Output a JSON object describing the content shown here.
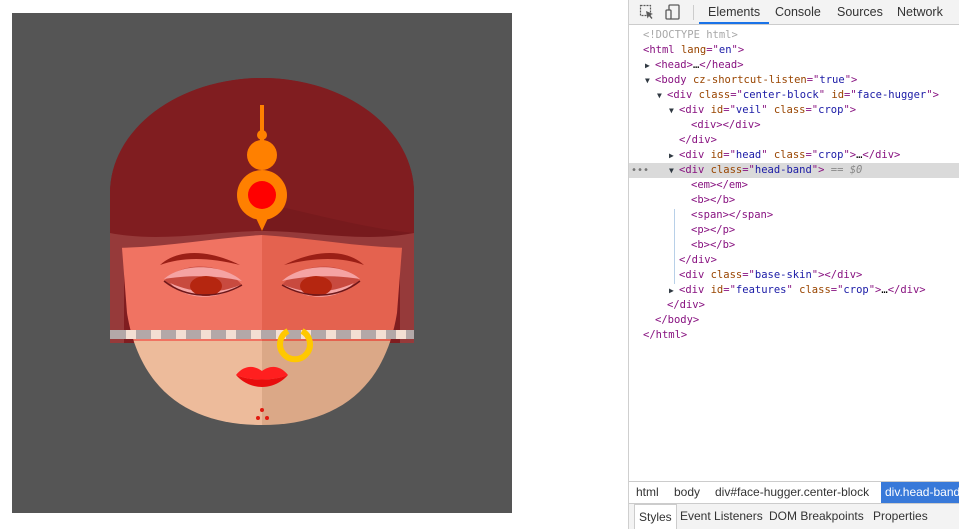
{
  "devtools": {
    "tabs": [
      {
        "label": "Elements",
        "active": true
      },
      {
        "label": "Console"
      },
      {
        "label": "Sources"
      },
      {
        "label": "Network"
      }
    ],
    "icons": [
      "select-element-icon",
      "device-toolbar-icon"
    ],
    "dom_lines": [
      {
        "tri": "",
        "parts": [
          [
            "doctype",
            "<!DOCTYPE html>"
          ]
        ]
      },
      {
        "tri": "",
        "parts": [
          [
            "tag",
            "<html "
          ],
          [
            "attr",
            "lang"
          ],
          [
            "tag",
            "=\""
          ],
          [
            "val",
            "en"
          ],
          [
            "tag",
            "\">"
          ]
        ]
      },
      {
        "tri": "▶",
        "parts": [
          [
            "tag",
            "<head>"
          ],
          [
            "plain",
            "…"
          ],
          [
            "tag",
            "</head>"
          ]
        ]
      },
      {
        "tri": "▼",
        "parts": [
          [
            "tag",
            "<body "
          ],
          [
            "attr",
            "cz-shortcut-listen"
          ],
          [
            "tag",
            "=\""
          ],
          [
            "val",
            "true"
          ],
          [
            "tag",
            "\">"
          ]
        ]
      },
      {
        "tri": "▼",
        "parts": [
          [
            "tag",
            "<div "
          ],
          [
            "attr",
            "class"
          ],
          [
            "tag",
            "=\""
          ],
          [
            "val",
            "center-block"
          ],
          [
            "tag",
            "\" "
          ],
          [
            "attr",
            "id"
          ],
          [
            "tag",
            "=\""
          ],
          [
            "val",
            "face-hugger"
          ],
          [
            "tag",
            "\">"
          ]
        ]
      },
      {
        "tri": "▼",
        "parts": [
          [
            "tag",
            "<div "
          ],
          [
            "attr",
            "id"
          ],
          [
            "tag",
            "=\""
          ],
          [
            "val",
            "veil"
          ],
          [
            "tag",
            "\" "
          ],
          [
            "attr",
            "class"
          ],
          [
            "tag",
            "=\""
          ],
          [
            "val",
            "crop"
          ],
          [
            "tag",
            "\">"
          ]
        ]
      },
      {
        "tri": "",
        "parts": [
          [
            "tag",
            "<div></div>"
          ]
        ]
      },
      {
        "tri": "",
        "parts": [
          [
            "tag",
            "</div>"
          ]
        ]
      },
      {
        "tri": "▶",
        "parts": [
          [
            "tag",
            "<div "
          ],
          [
            "attr",
            "id"
          ],
          [
            "tag",
            "=\""
          ],
          [
            "val",
            "head"
          ],
          [
            "tag",
            "\" "
          ],
          [
            "attr",
            "class"
          ],
          [
            "tag",
            "=\""
          ],
          [
            "val",
            "crop"
          ],
          [
            "tag",
            "\">"
          ],
          [
            "plain",
            "…"
          ],
          [
            "tag",
            "</div>"
          ]
        ]
      },
      {
        "tri": "▼",
        "selected": true,
        "parts": [
          [
            "tag",
            "<div "
          ],
          [
            "attr",
            "class"
          ],
          [
            "tag",
            "=\""
          ],
          [
            "val",
            "head-band"
          ],
          [
            "tag",
            "\">"
          ],
          [
            "eq",
            " == $0"
          ]
        ]
      },
      {
        "tri": "",
        "parts": [
          [
            "tag",
            "<em></em>"
          ]
        ]
      },
      {
        "tri": "",
        "parts": [
          [
            "tag",
            "<b></b>"
          ]
        ]
      },
      {
        "tri": "",
        "parts": [
          [
            "tag",
            "<span></span>"
          ]
        ]
      },
      {
        "tri": "",
        "parts": [
          [
            "tag",
            "<p></p>"
          ]
        ]
      },
      {
        "tri": "",
        "parts": [
          [
            "tag",
            "<b></b>"
          ]
        ]
      },
      {
        "tri": "",
        "parts": [
          [
            "tag",
            "</div>"
          ]
        ]
      },
      {
        "tri": "",
        "parts": [
          [
            "tag",
            "<div "
          ],
          [
            "attr",
            "class"
          ],
          [
            "tag",
            "=\""
          ],
          [
            "val",
            "base-skin"
          ],
          [
            "tag",
            "\"></div>"
          ]
        ]
      },
      {
        "tri": "▶",
        "parts": [
          [
            "tag",
            "<div "
          ],
          [
            "attr",
            "id"
          ],
          [
            "tag",
            "=\""
          ],
          [
            "val",
            "features"
          ],
          [
            "tag",
            "\" "
          ],
          [
            "attr",
            "class"
          ],
          [
            "tag",
            "=\""
          ],
          [
            "val",
            "crop"
          ],
          [
            "tag",
            "\">"
          ],
          [
            "plain",
            "…"
          ],
          [
            "tag",
            "</div>"
          ]
        ]
      },
      {
        "tri": "",
        "parts": [
          [
            "tag",
            "</div>"
          ]
        ]
      },
      {
        "tri": "",
        "parts": [
          [
            "tag",
            "</body>"
          ]
        ]
      },
      {
        "tri": "",
        "parts": [
          [
            "tag",
            "</html>"
          ]
        ]
      }
    ],
    "selected_ellipsis": "•••",
    "breadcrumbs": [
      {
        "label": "html"
      },
      {
        "label": "body"
      },
      {
        "label": "div#face-hugger.center-block"
      },
      {
        "label": "div.head-band",
        "active": true
      }
    ],
    "subtabs": [
      {
        "label": "Styles",
        "active": true
      },
      {
        "label": "Event Listeners"
      },
      {
        "label": "DOM Breakpoints"
      },
      {
        "label": "Properties"
      }
    ]
  },
  "colors": {
    "stage_bg": "#555555",
    "hair": "#801d20",
    "hair_dark": "#6e1719",
    "hair_band": "#963a3a",
    "skin_upper_left": "#f07362",
    "skin_upper_right": "#e4624f",
    "skin_lower_left": "#edbb9b",
    "skin_lower_right": "#dba887",
    "headband": "#b3a8a8",
    "ornament_orange": "#ff8000",
    "ornament_red": "#ff0000",
    "lips": "#ff1f1f",
    "nose_ring": "#ffc800",
    "dots": "#e01b10",
    "eye_lid": "#f5a3a3",
    "eye_iris": "#b52610",
    "eyebrow": "#9b1f16",
    "accent_blue": "#1a73e8"
  }
}
